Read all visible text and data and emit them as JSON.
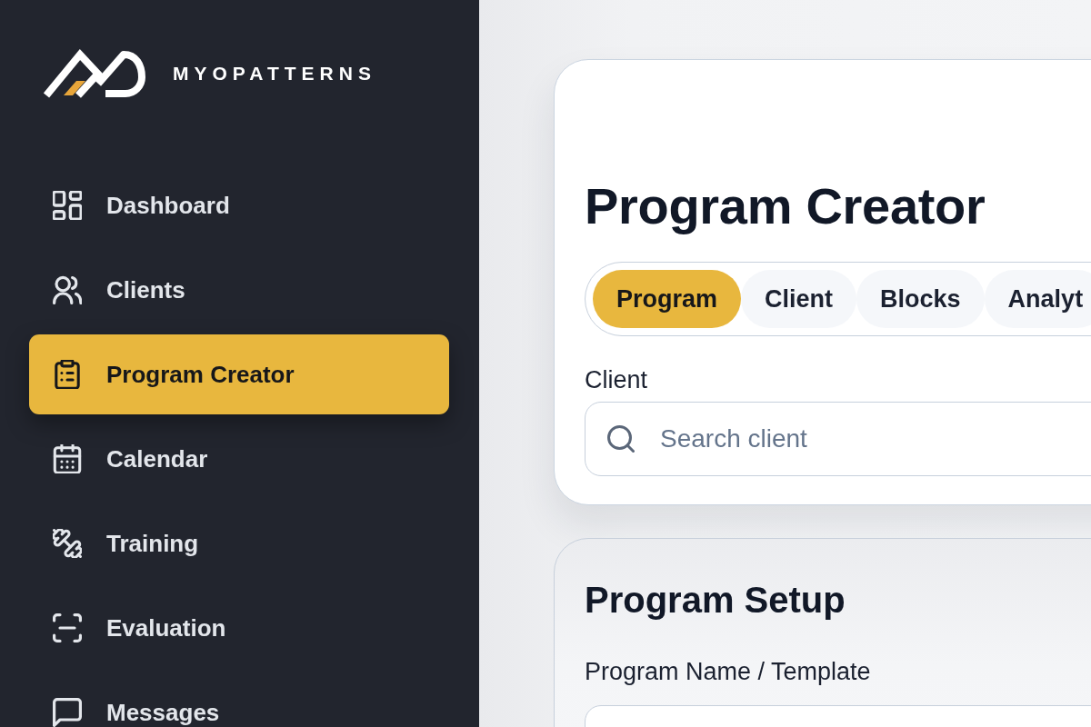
{
  "sidebar": {
    "brand": "MYOPATTERNS",
    "items": [
      {
        "label": "Dashboard",
        "selected": false
      },
      {
        "label": "Clients",
        "selected": false
      },
      {
        "label": "Program Creator",
        "selected": true
      },
      {
        "label": "Calendar",
        "selected": false
      },
      {
        "label": "Training",
        "selected": false
      },
      {
        "label": "Evaluation",
        "selected": false
      },
      {
        "label": "Messages",
        "selected": false
      }
    ]
  },
  "creator": {
    "title": "Program Creator",
    "tabs": [
      {
        "label": "Program",
        "selected": true
      },
      {
        "label": "Client",
        "selected": false
      },
      {
        "label": "Blocks",
        "selected": false
      },
      {
        "label": "Analyt",
        "selected": false
      }
    ],
    "client_field": {
      "label": "Client",
      "placeholder": "Search client"
    }
  },
  "setup": {
    "title": "Program Setup",
    "name_field": {
      "label": "Program Name / Template"
    }
  }
}
